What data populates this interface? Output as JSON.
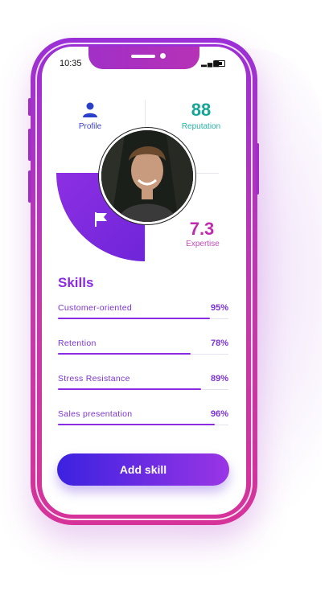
{
  "status_bar": {
    "time": "10:35"
  },
  "stats": {
    "profile": {
      "label": "Profile"
    },
    "reputation": {
      "value": "88",
      "label": "Reputation"
    },
    "expertise": {
      "value": "7.3",
      "label": "Expertise"
    }
  },
  "skills": {
    "title": "Skills",
    "items": [
      {
        "name": "Customer-oriented",
        "value": "95%",
        "level": 0.89
      },
      {
        "name": "Retention",
        "value": "78%",
        "level": 0.78
      },
      {
        "name": "Stress Resistance",
        "value": "89%",
        "level": 0.84
      },
      {
        "name": "Sales presentation",
        "value": "96%",
        "level": 0.92
      }
    ]
  },
  "add_button": {
    "label": "Add skill"
  },
  "colors": {
    "accent_purple": "#8a2be2",
    "teal": "#16a596",
    "magenta": "#c02cb0",
    "button_start": "#3b22e0",
    "button_end": "#9a35e5"
  },
  "icons": {
    "profile": "person-icon",
    "flag": "flag-icon"
  }
}
